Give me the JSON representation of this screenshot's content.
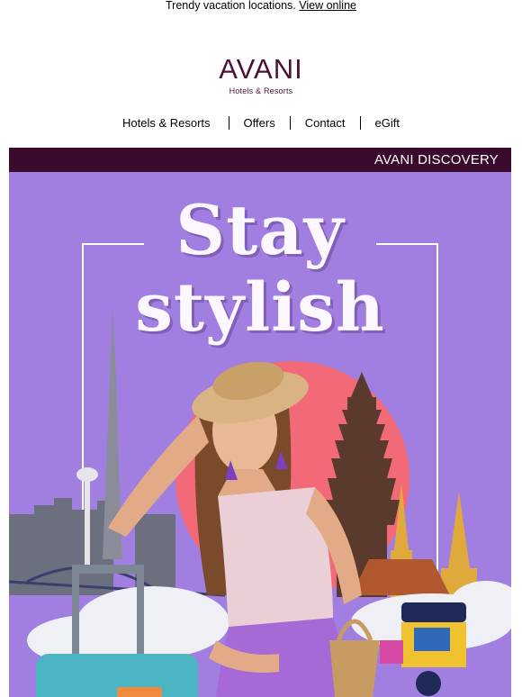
{
  "preheader": {
    "text": "Trendy vacation locations.",
    "link": "View online"
  },
  "brand": {
    "name": "AVANI",
    "tagline": "Hotels & Resorts",
    "color": "#4a1239"
  },
  "nav": {
    "items": [
      "Hotels & Resorts",
      "Offers",
      "Contact",
      "eGift"
    ]
  },
  "section_band": {
    "label": "AVANI DISCOVERY",
    "color": "#3b0b2d"
  },
  "hero": {
    "headline_line1": "Stay",
    "headline_line2": "stylish",
    "background": "#a07fe0",
    "accent_circle": "#f26a78"
  }
}
